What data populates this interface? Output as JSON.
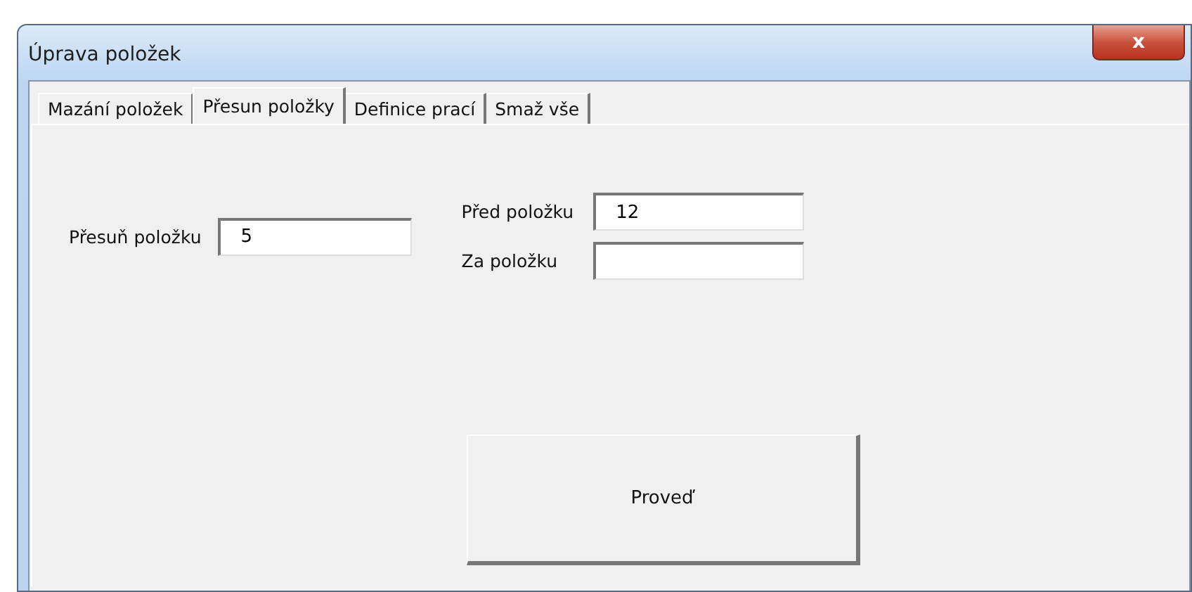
{
  "window": {
    "title": "Úprava položek",
    "close": "x"
  },
  "tabs": [
    {
      "label": "Mazání položek",
      "selected": false
    },
    {
      "label": "Přesun položky",
      "selected": true
    },
    {
      "label": "Definice prací",
      "selected": false
    },
    {
      "label": "Smaž vše",
      "selected": false
    }
  ],
  "move_item": {
    "label": "Přesuň položku",
    "value": "5"
  },
  "before_item": {
    "label": "Před položku",
    "value": "12"
  },
  "after_item": {
    "label": "Za položku"
  },
  "buttons": [
    "Proveď"
  ]
}
